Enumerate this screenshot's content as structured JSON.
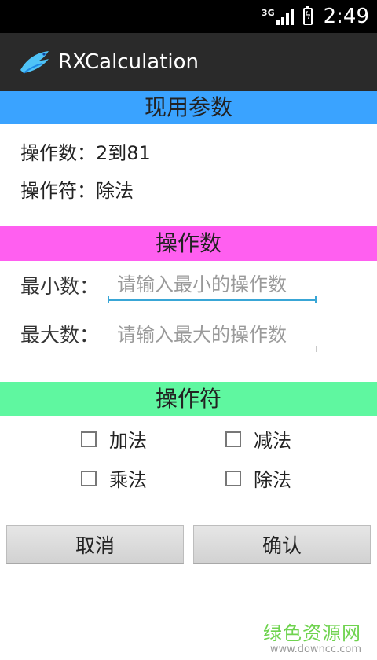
{
  "status_bar": {
    "network": "3G",
    "time": "2:49"
  },
  "action_bar": {
    "title": "RXCalculation",
    "icon": "bird-icon"
  },
  "current_params": {
    "header": "现用参数",
    "operand_range": "操作数：2到81",
    "operator": "操作符：除法"
  },
  "operand_section": {
    "header": "操作数",
    "min_label": "最小数：",
    "min_placeholder": "请输入最小的操作数",
    "min_value": "",
    "max_label": "最大数：",
    "max_placeholder": "请输入最大的操作数",
    "max_value": ""
  },
  "operator_section": {
    "header": "操作符",
    "options": [
      {
        "label": "加法",
        "checked": false
      },
      {
        "label": "减法",
        "checked": false
      },
      {
        "label": "乘法",
        "checked": false
      },
      {
        "label": "除法",
        "checked": false
      }
    ]
  },
  "buttons": {
    "cancel": "取消",
    "confirm": "确认"
  },
  "watermark": {
    "main": "绿色资源网",
    "sub": "www.downcc.com"
  },
  "colors": {
    "current_header": "#3aa3ff",
    "operand_header": "#ff5ff0",
    "operator_header": "#5ff7a0",
    "input_focus": "#39a6d6"
  }
}
